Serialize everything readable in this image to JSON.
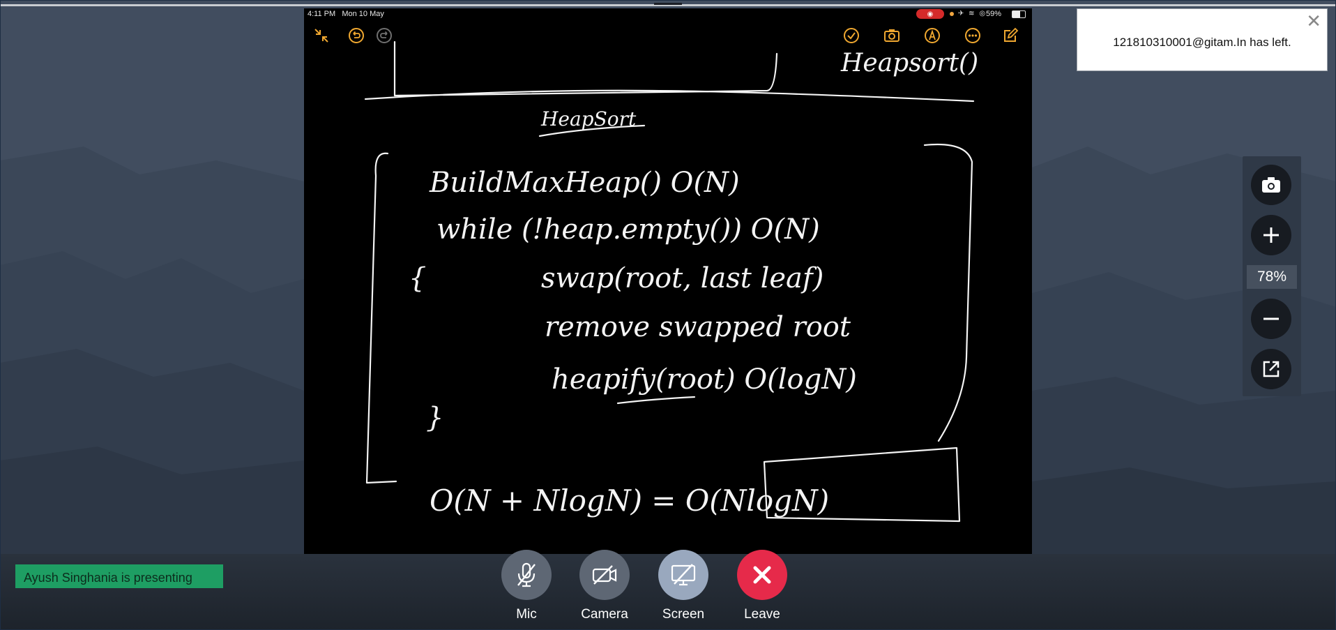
{
  "screen_share": {
    "status_time": "4:11 PM",
    "status_date": "Mon 10 May",
    "battery": "59%",
    "record_icon": "record-icon",
    "toolbar_left": [
      "collapse-icon",
      "undo-icon",
      "redo-icon"
    ],
    "toolbar_right": [
      "checkmark-icon",
      "camera-icon",
      "pen-icon",
      "more-icon",
      "compose-icon"
    ],
    "board_lines": [
      "Heapsort()",
      "HeapSort",
      "BuildMaxHeap() O(N)",
      "while (!heap.empty()) O(N)",
      "{",
      "swap(root, last leaf)",
      "remove swapped root",
      "heapify(root) O(logN)",
      "}",
      "O(N + NlogN) = O(NlogN)"
    ]
  },
  "notification": {
    "message": "121810310001@gitam.In has left.",
    "close_icon": "close-icon"
  },
  "zoom": {
    "level": "78%",
    "buttons": [
      "screenshot-icon",
      "zoom-in-icon",
      "zoom-out-icon",
      "popout-icon"
    ]
  },
  "presenter": {
    "banner": "Ayush Singhania is presenting"
  },
  "controls": {
    "mic": "Mic",
    "camera": "Camera",
    "screen": "Screen",
    "leave": "Leave"
  },
  "colors": {
    "accent": "#f0a830",
    "leave": "#e62a4a",
    "presenting": "#1e9e63",
    "background": "#3e4a5c"
  }
}
